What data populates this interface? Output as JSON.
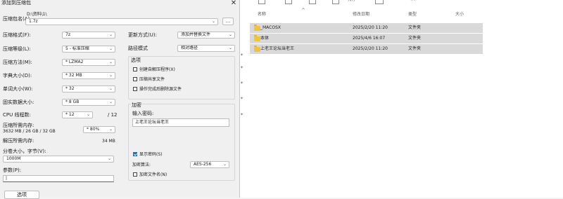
{
  "dialog": {
    "title": "添加到压缩包",
    "archive_name_label": "压缩包名(A)",
    "archive_path": "D:\\资料\\1\\",
    "archive_name": "1.7z",
    "browse_label": "...",
    "format_label": "压缩格式(F):",
    "format_value": "7z",
    "level_label": "压缩等级(L):",
    "level_value": "5 - 标准压缩",
    "method_label": "压缩方法(M):",
    "method_value": "* LZMA2",
    "dict_label": "字典大小(D):",
    "dict_value": "* 32 MB",
    "word_label": "单词大小(W):",
    "word_value": "* 32",
    "solid_label": "固实数据大小:",
    "solid_value": "* 8 GB",
    "threads_label": "CPU 线程数:",
    "threads_value": "* 12",
    "threads_total": "/ 12",
    "mem_compress_label": "压缩所需内存:",
    "mem_compress_detail": "3632 MB / 26 GB / 32 GB",
    "mem_percent_value": "* 80%",
    "mem_decompress_label": "解压所需内存:",
    "mem_decompress_value": "34 MB",
    "split_label": "分卷大小，字节(V):",
    "split_value": "1000M",
    "params_label": "参数(P):",
    "params_value": "|",
    "options_button": "选项",
    "update_mode_label": "更新方式(U):",
    "update_mode_value": "添加并替换文件",
    "path_mode_label": "路径模式",
    "path_mode_value": "相对路径",
    "options_group_title": "选项",
    "opt_sfx": "创建自解压程序(X)",
    "opt_shared": "压缩共享文件",
    "opt_delete": "操作完成后删除源文件",
    "encrypt_group_title": "加密",
    "password_label": "输入密码:",
    "password_value": "上老王论坛当老王",
    "show_password": "显示密码(S)",
    "enc_method_label": "加密算法:",
    "enc_method_value": "AES-256",
    "encrypt_names": "加密文件名(N)"
  },
  "explorer": {
    "toolbar_more": "···",
    "toolbar_partial": "排序",
    "columns": {
      "name": "名称",
      "date": "修改日期",
      "type": "类型",
      "size": "大小"
    },
    "files": [
      {
        "name": "_MACOSX",
        "date": "2025/2/20 11:20",
        "type": "文件夹"
      },
      {
        "name": "本体",
        "date": "2025/4/6 16:07",
        "type": "文件夹"
      },
      {
        "name": "上老王论坛当老王",
        "date": "2025/2/20 11:20",
        "type": "文件夹"
      }
    ]
  },
  "colors": {
    "accent": "#1c6fd1",
    "folder": "#f2c43b",
    "selection": "#d9d9d9"
  }
}
